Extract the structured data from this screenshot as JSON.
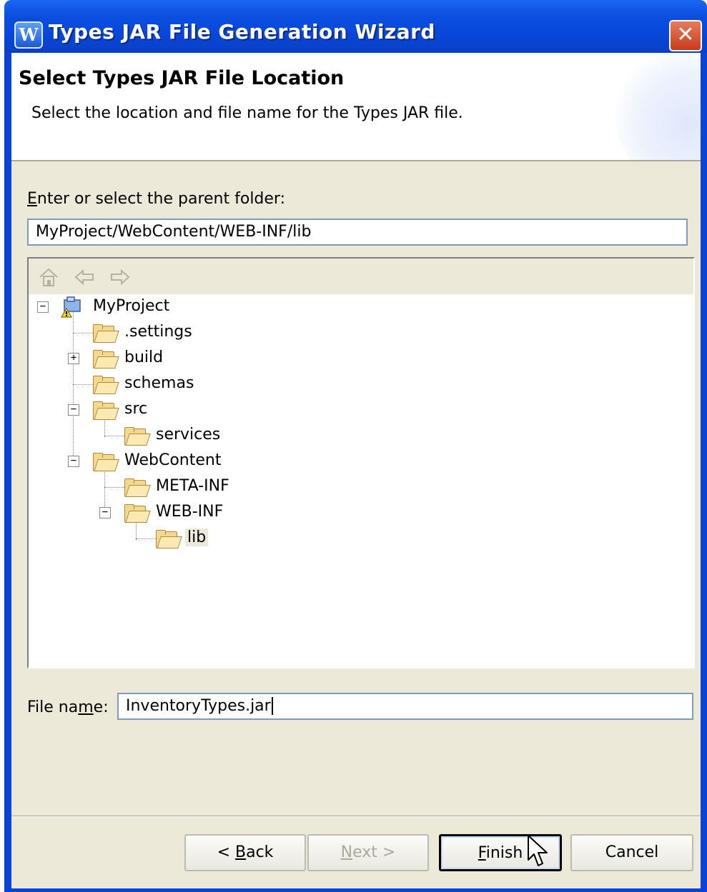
{
  "window": {
    "title": "Types JAR File Generation Wizard",
    "app_icon_letter": "W",
    "close_glyph": "✕"
  },
  "header": {
    "title": "Select Types JAR File Location",
    "description": "Select the location and file name for the Types JAR file."
  },
  "folder_section": {
    "label_mnemonic": "E",
    "label_rest": "nter or select the parent folder:",
    "path_value": "MyProject/WebContent/WEB-INF/lib"
  },
  "tree": {
    "toolbar": [
      "home-icon",
      "back-arrow-icon",
      "forward-arrow-icon"
    ],
    "nodes": [
      {
        "label": "MyProject",
        "expander": "−"
      },
      {
        "label": ".settings"
      },
      {
        "label": "build",
        "expander": "+"
      },
      {
        "label": "schemas"
      },
      {
        "label": "src",
        "expander": "−"
      },
      {
        "label": "services"
      },
      {
        "label": "WebContent",
        "expander": "−"
      },
      {
        "label": "META-INF"
      },
      {
        "label": "WEB-INF",
        "expander": "−"
      },
      {
        "label": "lib",
        "selected": true
      }
    ]
  },
  "file_name": {
    "label_pre": "File na",
    "label_mnemonic": "m",
    "label_post": "e:",
    "value": "InventoryTypes.jar"
  },
  "buttons": {
    "back_prefix": "< ",
    "back_mnemonic": "B",
    "back_rest": "ack",
    "next_mnemonic": "N",
    "next_rest": "ext >",
    "finish_mnemonic": "F",
    "finish_rest": "inish",
    "cancel": "Cancel"
  },
  "colors": {
    "titlebar": "#0a4fe0",
    "dialog_bg": "#ece9d8",
    "input_border": "#7f9db9"
  }
}
